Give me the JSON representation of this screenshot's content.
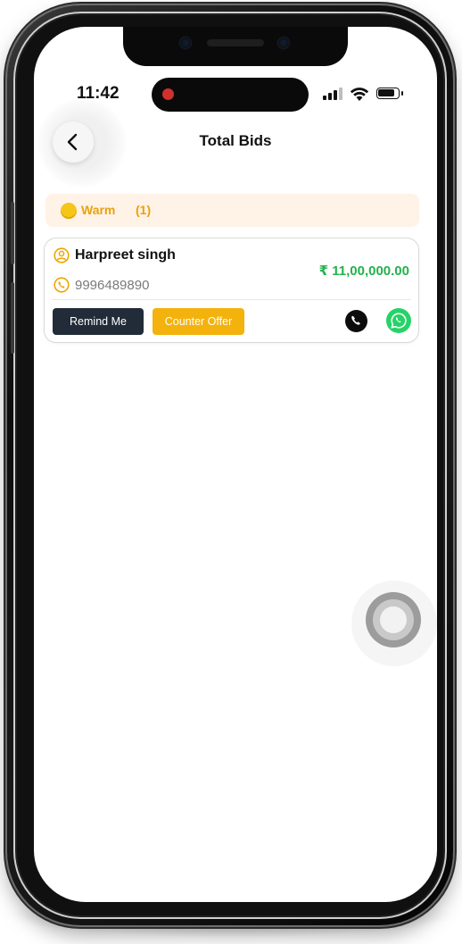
{
  "status_bar": {
    "time": "11:42",
    "icons": [
      "recording-dot-icon",
      "cellular-signal-icon",
      "wifi-icon",
      "battery-icon"
    ]
  },
  "header": {
    "back_icon": "chevron-left-icon",
    "title": "Total Bids"
  },
  "group": {
    "label": "Warm",
    "count": "(1)",
    "dot_color": "#f5c518",
    "text_color": "#e8a20c",
    "background": "#fff2e6"
  },
  "bids": [
    {
      "name": "Harpreet singh",
      "phone": "9996489890",
      "amount": "₹ 11,00,000.00",
      "amount_color": "#22b24c",
      "remind_label": "Remind Me",
      "counter_label": "Counter Offer",
      "icons": [
        "person-icon",
        "phone-icon",
        "call-icon",
        "whatsapp-icon"
      ]
    }
  ],
  "colors": {
    "remind_button": "#222b38",
    "counter_button": "#f4b20d",
    "whatsapp": "#25d366"
  }
}
